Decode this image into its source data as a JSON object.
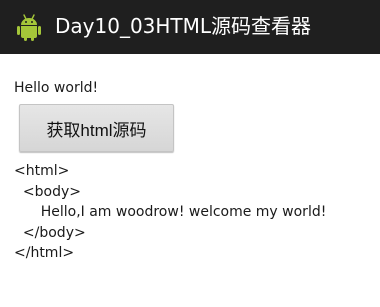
{
  "app": {
    "title": "Day10_03HTML源码查看器",
    "icon": "android-icon",
    "title_bar_color": "#1f1f1f",
    "icon_color": "#a4c639"
  },
  "main": {
    "hello_text": "Hello world!",
    "fetch_button_label": "获取html源码",
    "source_lines": [
      "<html>",
      "  <body>",
      "      Hello,I am woodrow! welcome my world!",
      "  </body>",
      "</html>"
    ]
  }
}
